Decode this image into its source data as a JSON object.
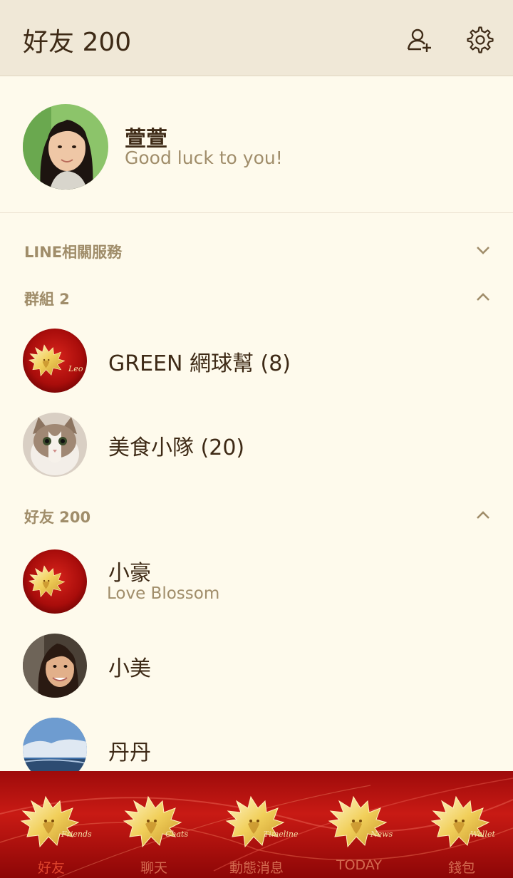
{
  "header": {
    "title": "好友 200",
    "add_friend_icon": "person-add-icon",
    "settings_icon": "gear-icon"
  },
  "profile": {
    "name": "萱萱",
    "status": "Good luck to you!"
  },
  "sections": {
    "services": {
      "label": "LINE相關服務",
      "chevron": "chevron-down-icon"
    },
    "groups": {
      "label": "群組 2",
      "chevron": "chevron-up-icon"
    },
    "friends": {
      "label": "好友 200",
      "chevron": "chevron-up-icon"
    }
  },
  "groups": [
    {
      "name": "GREEN 網球幫 (8)",
      "avatar_text": "Leo"
    },
    {
      "name": "美食小隊 (20)"
    }
  ],
  "friends": [
    {
      "name": "小豪",
      "status": "Love Blossom"
    },
    {
      "name": "小美"
    },
    {
      "name": "丹丹"
    }
  ],
  "tabs": [
    {
      "label": "好友",
      "script": "Friends",
      "active": true
    },
    {
      "label": "聊天",
      "script": "Chats"
    },
    {
      "label": "動態消息",
      "script": "Timeline"
    },
    {
      "label": "TODAY",
      "script": "News"
    },
    {
      "label": "錢包",
      "script": "Wallet"
    }
  ],
  "colors": {
    "background": "#fefaec",
    "header": "#f0e8d7",
    "muted_text": "#a08d6a",
    "primary_text": "#3e2a16",
    "tab_bar": "#b5110f"
  }
}
